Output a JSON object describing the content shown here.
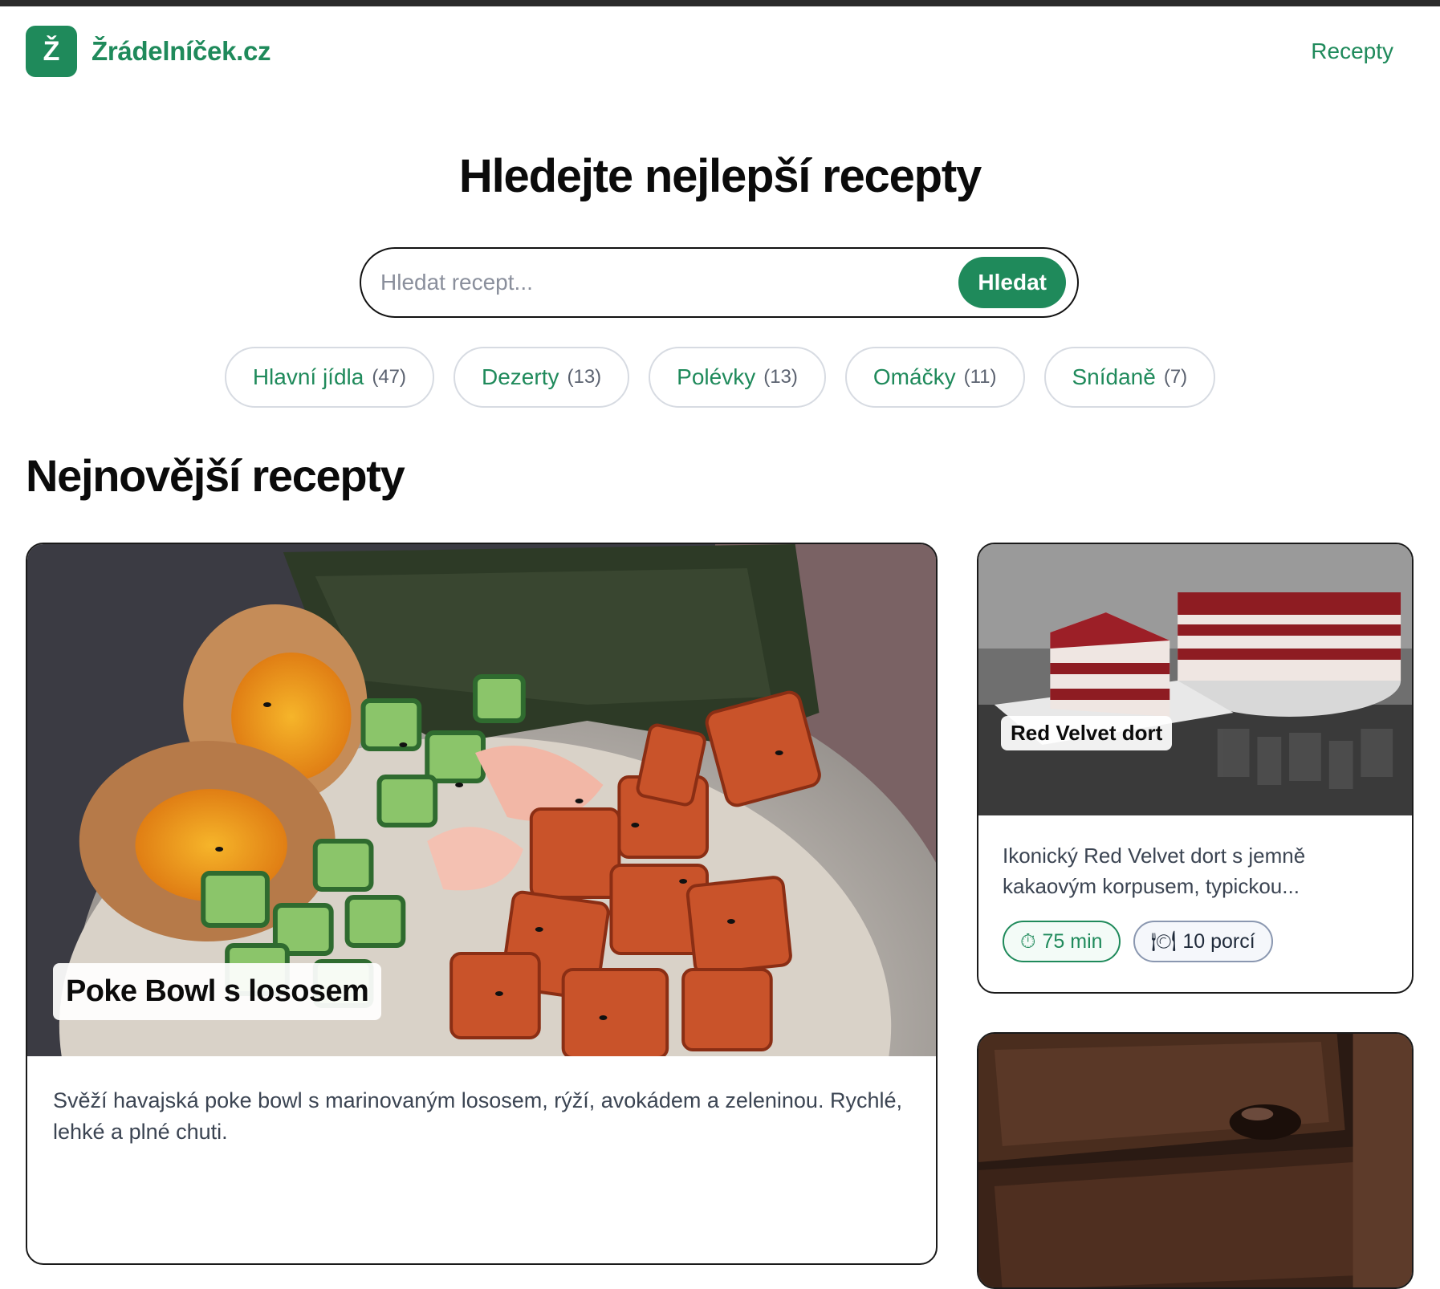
{
  "brand": {
    "logo_letter": "Ž",
    "name": "Žrádelníček.cz",
    "color": "#1f8a5b"
  },
  "nav": {
    "recipes_link": "Recepty"
  },
  "hero": {
    "title": "Hledejte nejlepší recepty",
    "search_placeholder": "Hledat recept...",
    "search_button": "Hledat"
  },
  "categories": [
    {
      "label": "Hlavní jídla",
      "count": "(47)"
    },
    {
      "label": "Dezerty",
      "count": "(13)"
    },
    {
      "label": "Polévky",
      "count": "(13)"
    },
    {
      "label": "Omáčky",
      "count": "(11)"
    },
    {
      "label": "Snídaně",
      "count": "(7)"
    }
  ],
  "latest": {
    "title": "Nejnovější recepty",
    "featured": {
      "title": "Poke Bowl s lososem",
      "description": "Svěží havajská poke bowl s marinovaným lososem, rýží, avokádem a zeleninou. Rychlé, lehké a plné chuti."
    },
    "cards": [
      {
        "title": "Red Velvet dort",
        "description": "Ikonický Red Velvet dort s jemně kakaovým korpusem, typickou...",
        "time": "75 min",
        "servings": "10 porcí",
        "time_icon": "⏱",
        "servings_icon": "🍽"
      }
    ]
  }
}
